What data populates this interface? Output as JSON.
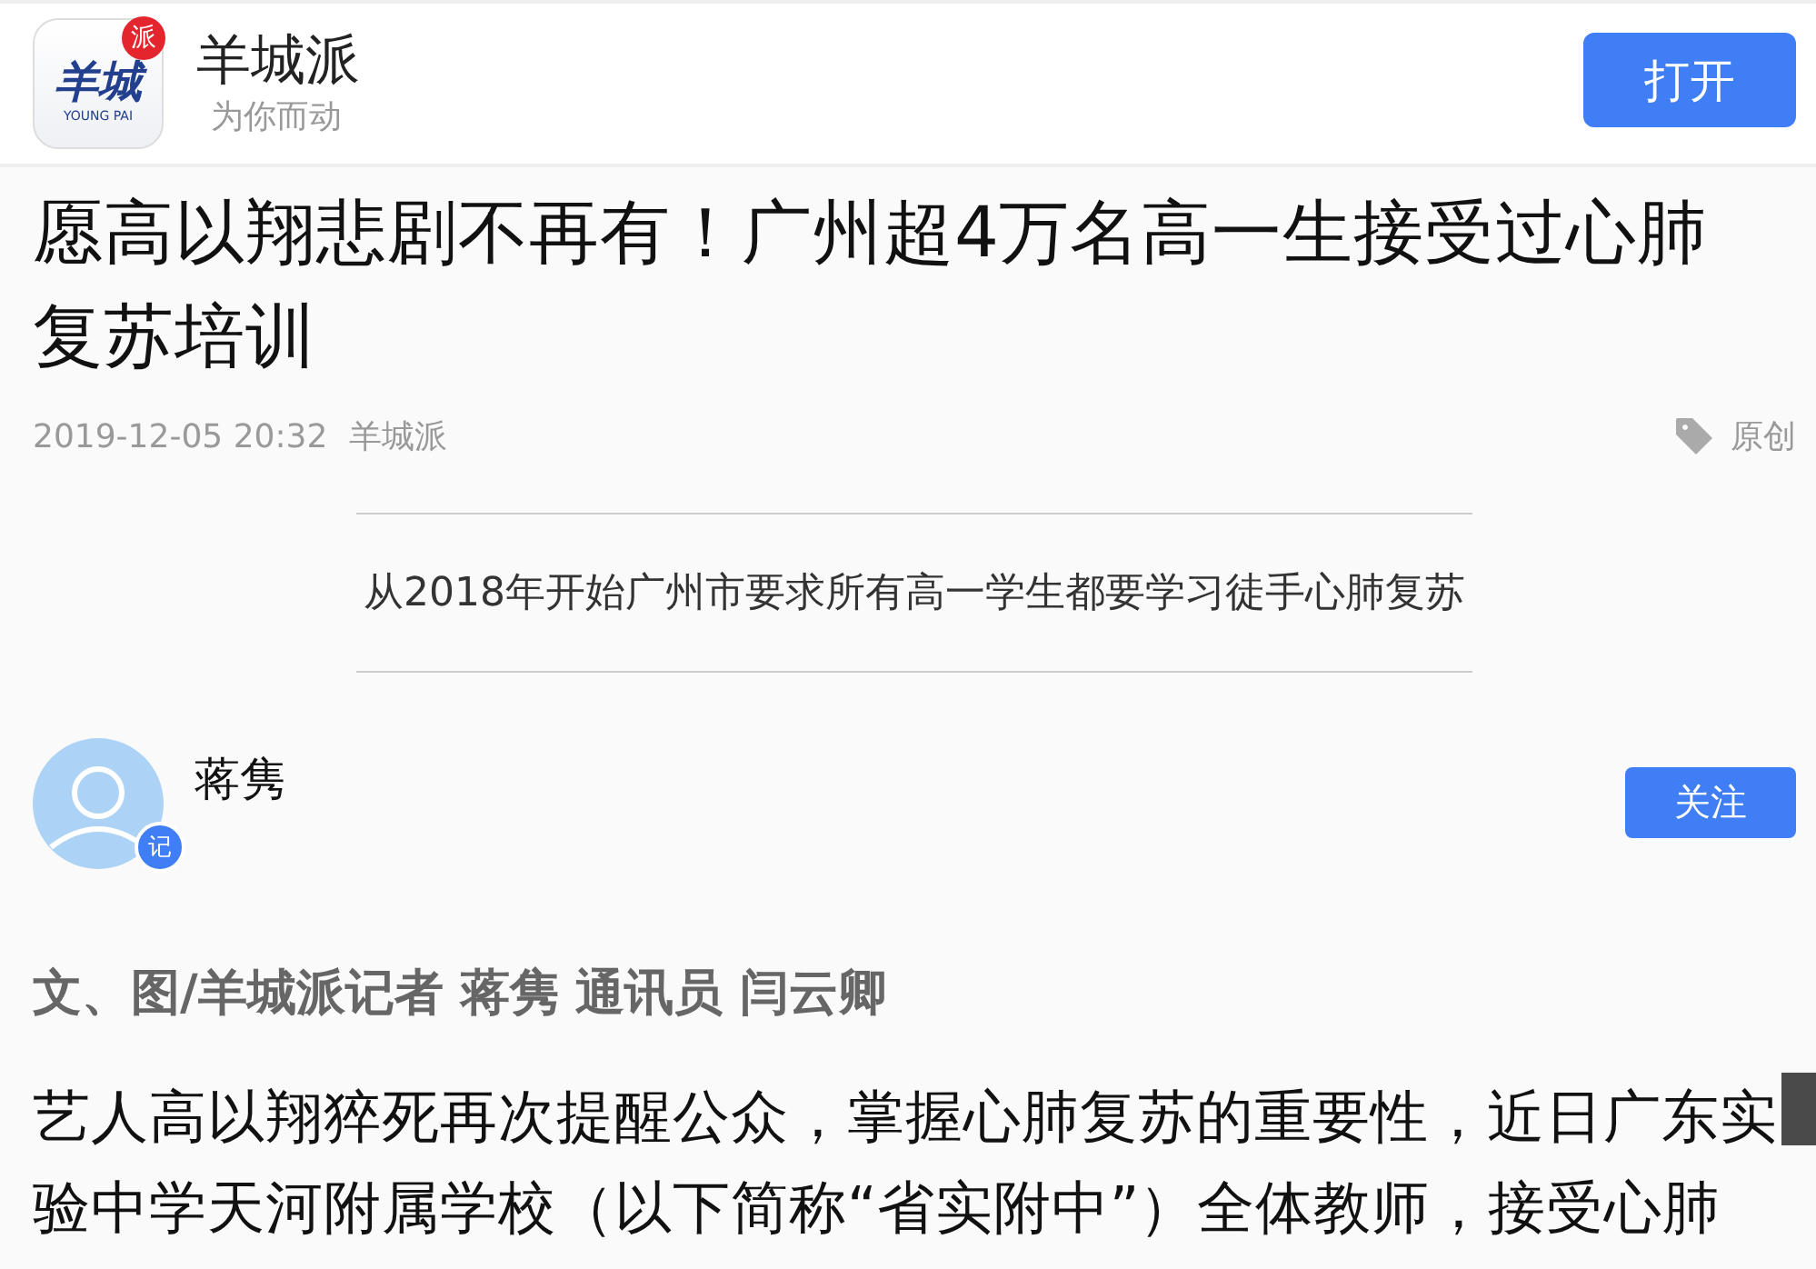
{
  "app_banner": {
    "logo": {
      "main": "羊城",
      "badge": "派",
      "sub": "YOUNG PAI"
    },
    "name": "羊城派",
    "slogan": "为你而动",
    "open_button": "打开"
  },
  "article": {
    "title": "愿高以翔悲剧不再有！广州超4万名高一生接受过心肺复苏培训",
    "date": "2019-12-05 20:32",
    "source": "羊城派",
    "tag": "原创",
    "caption": "从2018年开始广州市要求所有高一学生都要学习徒手心肺复苏",
    "author": {
      "name": "蒋隽",
      "badge": "记",
      "follow_button": "关注"
    },
    "byline": "文、图/羊城派记者 蒋隽 通讯员 闫云卿",
    "body": "艺人高以翔猝死再次提醒公众，掌握心肺复苏的重要性，近日广东实验中学天河附属学校（以下简称“省实附中”）全体教师，接受心肺"
  }
}
